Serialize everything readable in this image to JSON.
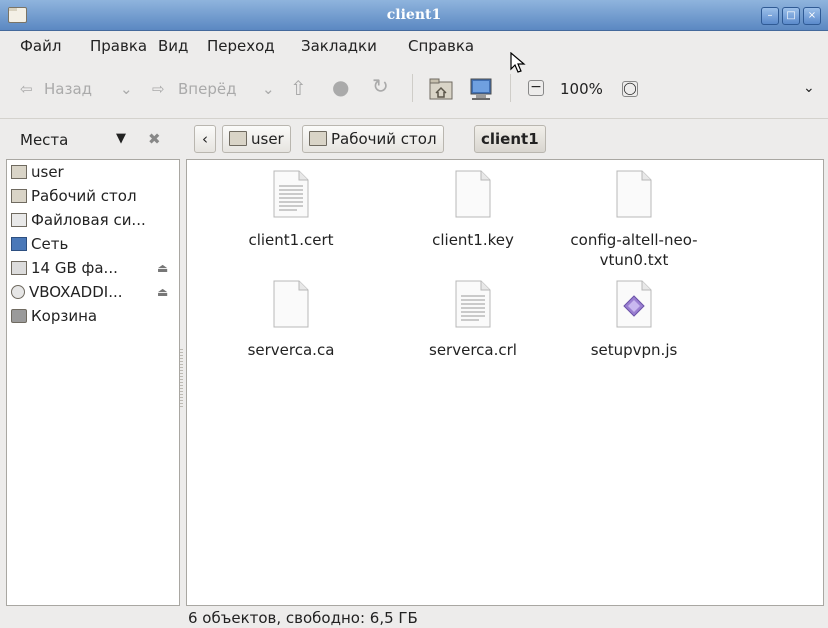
{
  "window": {
    "title": "client1"
  },
  "menu": [
    "Файл",
    "Правка",
    "Вид",
    "Переход",
    "Закладки",
    "Справка"
  ],
  "toolbar": {
    "back": "Назад",
    "forward": "Вперёд",
    "zoom": "100%"
  },
  "sidebar": {
    "header": "Места",
    "items": [
      {
        "label": "user",
        "icon": "home-folder-icon"
      },
      {
        "label": "Рабочий стол",
        "icon": "desktop-folder-icon"
      },
      {
        "label": "Файловая си...",
        "icon": "filesystem-icon"
      },
      {
        "label": "Сеть",
        "icon": "network-icon"
      },
      {
        "label": "14 GB фа...",
        "icon": "drive-icon",
        "eject": true
      },
      {
        "label": "VBOXADDI...",
        "icon": "cdrom-icon",
        "eject": true
      },
      {
        "label": "Корзина",
        "icon": "trash-icon"
      }
    ]
  },
  "breadcrumb": [
    "user",
    "Рабочий стол",
    "client1"
  ],
  "files": [
    {
      "name": "client1.cert",
      "type": "text"
    },
    {
      "name": "client1.key",
      "type": "blank"
    },
    {
      "name": "config-altell-neo-vtun0.txt",
      "type": "blank"
    },
    {
      "name": "serverca.ca",
      "type": "blank"
    },
    {
      "name": "serverca.crl",
      "type": "text"
    },
    {
      "name": "setupvpn.js",
      "type": "script"
    }
  ],
  "status": "6 объектов, свободно: 6,5 ГБ",
  "colors": {
    "titlebar": "#5b88c2",
    "background": "#edeceb",
    "script_icon": "#9a7fd1"
  }
}
